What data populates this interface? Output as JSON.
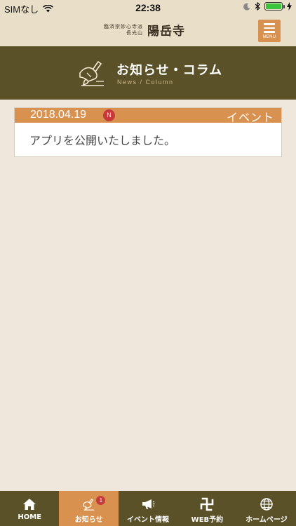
{
  "status_bar": {
    "carrier": "SIMなし",
    "time": "22:38"
  },
  "header": {
    "logo_line1": "臨済宗妙心寺派",
    "logo_line2": "長光山",
    "logo_main": "陽岳寺",
    "menu_label": "MENU"
  },
  "banner": {
    "title": "お知らせ・コラム",
    "subtitle": "News / Column",
    "icon": "writing-hand-icon"
  },
  "news": [
    {
      "date": "2018.04.19",
      "new_badge": "N",
      "category": "イベント",
      "title": "アプリを公開いたしました。"
    }
  ],
  "tabs": [
    {
      "label": "HOME",
      "icon": "home-icon",
      "active": false
    },
    {
      "label": "お知らせ",
      "icon": "writing-hand-icon",
      "active": true,
      "badge": "1"
    },
    {
      "label": "イベント情報",
      "icon": "megaphone-icon",
      "active": false
    },
    {
      "label": "WEB予約",
      "icon": "manji-icon",
      "active": false
    },
    {
      "label": "ホームページ",
      "icon": "globe-icon",
      "active": false
    }
  ],
  "colors": {
    "header_bg": "#e9dfc9",
    "banner_bg": "#5b5129",
    "accent": "#d99150",
    "page_bg": "#f0e7dc",
    "badge": "#c53b3b"
  }
}
